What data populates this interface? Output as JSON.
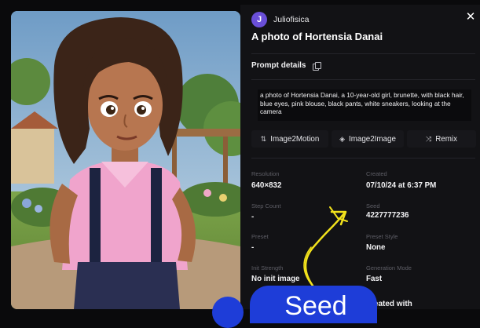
{
  "user": {
    "initial": "J",
    "name": "Juliofisica"
  },
  "close_icon": "close-icon",
  "title": "A photo of Hortensia Danai",
  "prompt": {
    "header": "Prompt details",
    "text": "a photo of Hortensia Danai, a 10-year-old girl, brunette, with black hair, blue eyes, pink blouse, black pants, white sneakers, looking at the camera"
  },
  "actions": [
    {
      "label": "Image2Motion",
      "icon": "motion-icon"
    },
    {
      "label": "Image2Image",
      "icon": "layers-icon"
    },
    {
      "label": "Remix",
      "icon": "remix-icon"
    }
  ],
  "meta": {
    "resolution": {
      "label": "Resolution",
      "value": "640×832"
    },
    "created": {
      "label": "Created",
      "value": "07/10/24 at 6:37 PM"
    },
    "step_count": {
      "label": "Step Count",
      "value": "-"
    },
    "seed": {
      "label": "Seed",
      "value": "4227777236"
    },
    "preset": {
      "label": "Preset",
      "value": "-"
    },
    "preset_style": {
      "label": "Preset Style",
      "value": "None"
    },
    "init_strength": {
      "label": "Init Strength",
      "value": "No init image"
    },
    "generation_mode": {
      "label": "Generation Mode",
      "value": "Fast"
    }
  },
  "created_with": "reated with",
  "overlay": {
    "seed_text": "Seed",
    "annotation_color": "#f2e21c",
    "badge_color": "#1e3dd8"
  },
  "colors": {
    "accent": "#6a4fd8",
    "panel": "#121215",
    "background": "#0a0a0c"
  }
}
